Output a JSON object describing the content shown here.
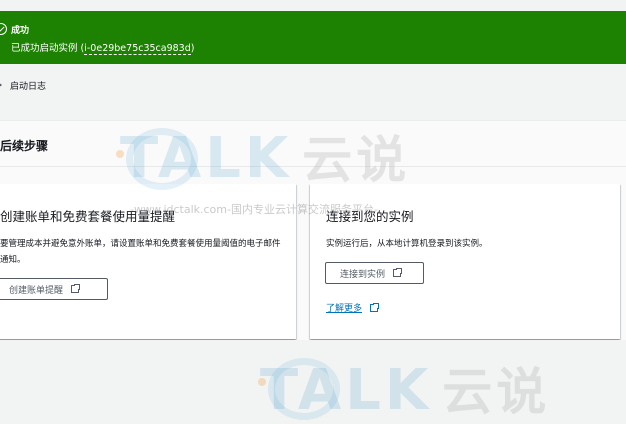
{
  "flash": {
    "title": "成功",
    "message_prefix": "已成功启动实例 (",
    "instance_id": "i-0e29be75c35ca983d",
    "message_suffix": ")",
    "color": "#1d8102"
  },
  "log": {
    "label": "启动日志"
  },
  "next_steps": {
    "title": "后续步骤",
    "cards": [
      {
        "title": "创建账单和免费套餐使用量提醒",
        "description": "要管理成本并避免意外账单，请设置账单和免费套餐使用量阈值的电子邮件通知。",
        "button_label": "创建账单提醒",
        "button_icon": "external-link-icon"
      },
      {
        "title": "连接到您的实例",
        "description": "实例运行后，从本地计算机登录到该实例。",
        "button_label": "连接到实例",
        "button_icon": "external-link-icon",
        "link_label": "了解更多",
        "link_color": "#0073bb"
      }
    ]
  },
  "watermark": {
    "brand": "TALK",
    "cn": "云说",
    "tagline": "-www.idctalk.com-国内专业云计算交流服务平台-"
  }
}
